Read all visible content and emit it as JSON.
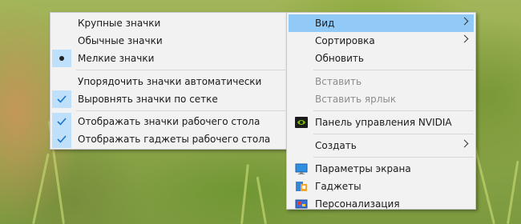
{
  "submenu_view": {
    "items": [
      {
        "label": "Крупные значки",
        "mark": "none"
      },
      {
        "label": "Обычные значки",
        "mark": "none"
      },
      {
        "label": "Мелкие значки",
        "mark": "bullet"
      },
      {
        "label": "Упорядочить значки автоматически",
        "mark": "none"
      },
      {
        "label": "Выровнять значки по сетке",
        "mark": "check"
      },
      {
        "label": "Отображать значки рабочего стола",
        "mark": "check"
      },
      {
        "label": "Отображать гаджеты  рабочего стола",
        "mark": "check"
      }
    ]
  },
  "context_menu": {
    "items": [
      {
        "label": "Вид",
        "has_submenu": true,
        "highlighted": true
      },
      {
        "label": "Сортировка",
        "has_submenu": true
      },
      {
        "label": "Обновить"
      },
      {
        "label": "Вставить",
        "disabled": true
      },
      {
        "label": "Вставить ярлык",
        "disabled": true
      },
      {
        "label": "Панель управления NVIDIA",
        "icon": "nvidia-icon"
      },
      {
        "label": "Создать",
        "has_submenu": true
      },
      {
        "label": "Параметры экрана",
        "icon": "display-settings-icon"
      },
      {
        "label": "Гаджеты",
        "icon": "gadgets-icon"
      },
      {
        "label": "Персонализация",
        "icon": "personalization-icon"
      }
    ]
  },
  "colors": {
    "highlight": "#91c9f7",
    "check_background": "#bfe0fb",
    "menu_background": "#f2f2f2",
    "check_mark": "#1a73c8"
  }
}
